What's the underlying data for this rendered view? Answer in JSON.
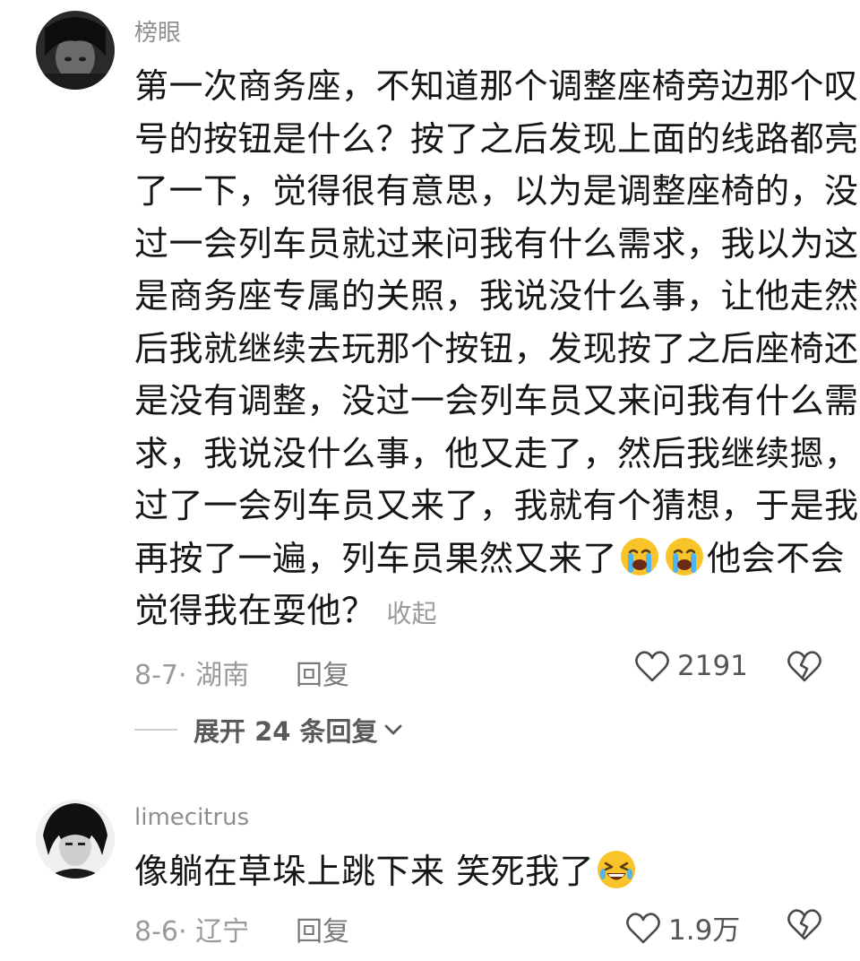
{
  "comments": [
    {
      "username": "榜眼",
      "lines": [
        "第一次商务座，不知道那个调整座椅旁边那个叹",
        "号的按钮是什么？按了之后发现上面的线路都亮",
        "了一下，觉得很有意思，以为是调整座椅的，没",
        "过一会列车员就过来问我有什么需求，我以为这",
        "是商务座专属的关照，我说没什么事，让他走然",
        "后我就继续去玩那个按钮，发现按了之后座椅还",
        "是没有调整，没过一会列车员又来问我有什么需",
        "求，我说没什么事，他又走了，然后我继续摁，",
        "过了一会列车员又来了，我就有个猜想，于是我"
      ],
      "line10_prefix": "再按了一遍，列车员果然又来了",
      "line10_suffix": "他会不会",
      "line11": "觉得我在耍他？",
      "collapse_label": "收起",
      "emoji_names": [
        "loudly-crying-emoji",
        "loudly-crying-emoji"
      ],
      "date_location": "8-7· 湖南",
      "reply_label": "回复",
      "like_count": "2191",
      "expand_label": "展开 24 条回复"
    },
    {
      "username": "limecitrus",
      "text": "像躺在草垛上跳下来 笑死我了",
      "emoji_name": "rolling-laughing-emoji",
      "date_location": "8-6· 辽宁",
      "reply_label": "回复",
      "like_count": "1.9万"
    }
  ],
  "icons": {
    "like": "heart-outline-icon",
    "dislike": "broken-heart-icon",
    "expand": "chevron-down-icon"
  },
  "colors": {
    "text": "#161616",
    "muted": "#9a9a9a",
    "emoji_face": "#f9c42a"
  }
}
